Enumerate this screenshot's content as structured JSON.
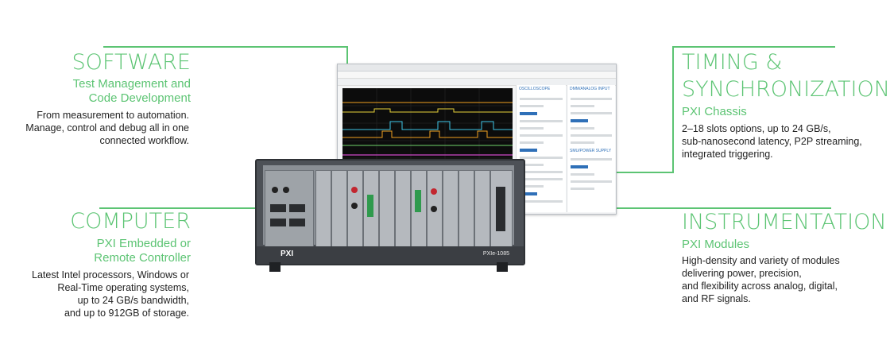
{
  "software": {
    "title": "SOFTWARE",
    "subtitle_l1": "Test Management and",
    "subtitle_l2": "Code Development",
    "body": [
      "From measurement to automation.",
      "Manage, control and debug all in one",
      "connected workflow."
    ]
  },
  "computer": {
    "title": "COMPUTER",
    "subtitle_l1": "PXI Embedded or",
    "subtitle_l2": "Remote Controller",
    "body": [
      "Latest Intel processors, Windows or",
      "Real-Time operating systems,",
      "up to 24 GB/s bandwidth,",
      "and up to 912GB of storage."
    ]
  },
  "timing": {
    "title_l1": "TIMING &",
    "title_l2": "SYNCHRONIZATION",
    "subtitle": "PXI Chassis",
    "body": [
      "2–18 slots options, up to 24 GB/s,",
      "sub-nanosecond latency, P2P streaming,",
      "integrated triggering."
    ]
  },
  "instrumentation": {
    "title": "INSTRUMENTATION",
    "subtitle": "PXI Modules",
    "body": [
      "High-density and variety of modules",
      "delivering power, precision,",
      "and flexibility across analog, digital,",
      "and RF signals."
    ]
  },
  "screen": {
    "panel1_title": "OSCILLOSCOPE",
    "panel2_title": "DMM/ANALOG INPUT",
    "panel3_title": "SMU/POWER SUPPLY"
  },
  "chassis": {
    "brand": "PXI",
    "model": "PXIe-1085"
  },
  "colors": {
    "accent": "#5cc473",
    "body_text": "#222222"
  }
}
